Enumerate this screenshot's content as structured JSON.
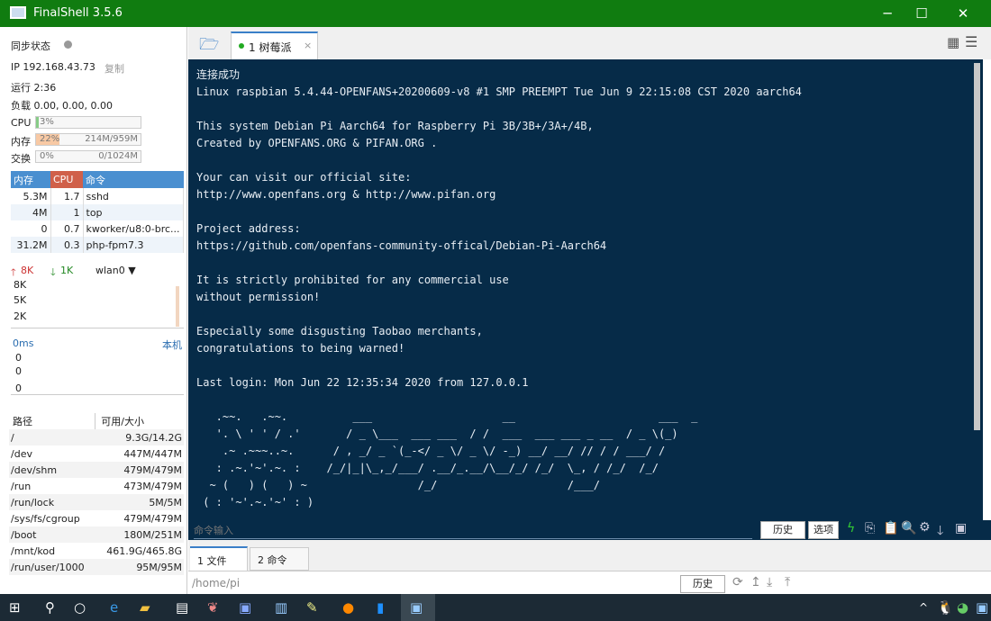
{
  "app": {
    "title": "FinalShell 3.5.6"
  },
  "left": {
    "sync_label": "同步状态",
    "ip": "IP 192.168.43.73",
    "copy": "复制",
    "uptime": "运行 2:36",
    "load": "负载 0.00, 0.00, 0.00",
    "cpu": {
      "label": "CPU",
      "percent": "3%",
      "fill": 3
    },
    "mem": {
      "label": "内存",
      "percent": "22%",
      "value": "214M/959M",
      "fill": 22
    },
    "swap": {
      "label": "交换",
      "percent": "0%",
      "value": "0/1024M",
      "fill": 0
    },
    "proc_headers": [
      "内存",
      "CPU",
      "命令"
    ],
    "procs": [
      [
        "5.3M",
        "1.7",
        "sshd"
      ],
      [
        "4M",
        "1",
        "top"
      ],
      [
        "0",
        "0.7",
        "kworker/u8:0-brc..."
      ],
      [
        "31.2M",
        "0.3",
        "php-fpm7.3"
      ]
    ],
    "net": {
      "up": "8K",
      "down": "1K",
      "iface": "wlan0",
      "ticks": [
        "8K",
        "5K",
        "2K"
      ]
    },
    "ping": {
      "ms": "0ms",
      "host": "本机",
      "ticks": [
        "0",
        "0",
        "0"
      ]
    },
    "disk_headers": [
      "路径",
      "可用/大小"
    ],
    "disks": [
      [
        "/",
        "9.3G/14.2G"
      ],
      [
        "/dev",
        "447M/447M"
      ],
      [
        "/dev/shm",
        "479M/479M"
      ],
      [
        "/run",
        "473M/479M"
      ],
      [
        "/run/lock",
        "5M/5M"
      ],
      [
        "/sys/fs/cgroup",
        "479M/479M"
      ],
      [
        "/boot",
        "180M/251M"
      ],
      [
        "/mnt/kod",
        "461.9G/465.8G"
      ],
      [
        "/run/user/1000",
        "95M/95M"
      ]
    ]
  },
  "tabs": {
    "session": "1 树莓派"
  },
  "terminal": {
    "text": "连接成功\nLinux raspbian 5.4.44-OPENFANS+20200609-v8 #1 SMP PREEMPT Tue Jun 9 22:15:08 CST 2020 aarch64\n\nThis system Debian Pi Aarch64 for Raspberry Pi 3B/3B+/3A+/4B,\nCreated by OPENFANS.ORG & PIFAN.ORG .\n\nYour can visit our official site:\nhttp://www.openfans.org & http://www.pifan.org\n\nProject address:\nhttps://github.com/openfans-community-offical/Debian-Pi-Aarch64\n\nIt is strictly prohibited for any commercial use\nwithout permission!\n\nEspecially some disgusting Taobao merchants,\ncongratulations to being warned!\n\nLast login: Mon Jun 22 12:35:34 2020 from 127.0.0.1\n\n   .~~.   .~~.          ___                    __                      ___  _\n   '. \\ ' ' / .'       / _ \\___  ___ ___  / /  ___  ___ ___ _ __  / _ \\(_)\n    .~ .~~~..~.      / , _/ _ `(_-</ _ \\/ _ \\/ -_) __/ __/ // / / ___/ /\n   : .~.'~'.~. :    /_/|_|\\_,_/___/ .__/_.__/\\__/_/ /_/  \\_, / /_/  /_/\n  ~ (   ) (   ) ~                 /_/                    /___/\n ( : '~'.~.'~' : )"
  },
  "command": {
    "placeholder": "命令输入",
    "history": "历史",
    "options": "选项"
  },
  "bottom": {
    "tab1": "1 文件",
    "tab2": "2 命令",
    "path": "/home/pi",
    "history": "历史"
  }
}
